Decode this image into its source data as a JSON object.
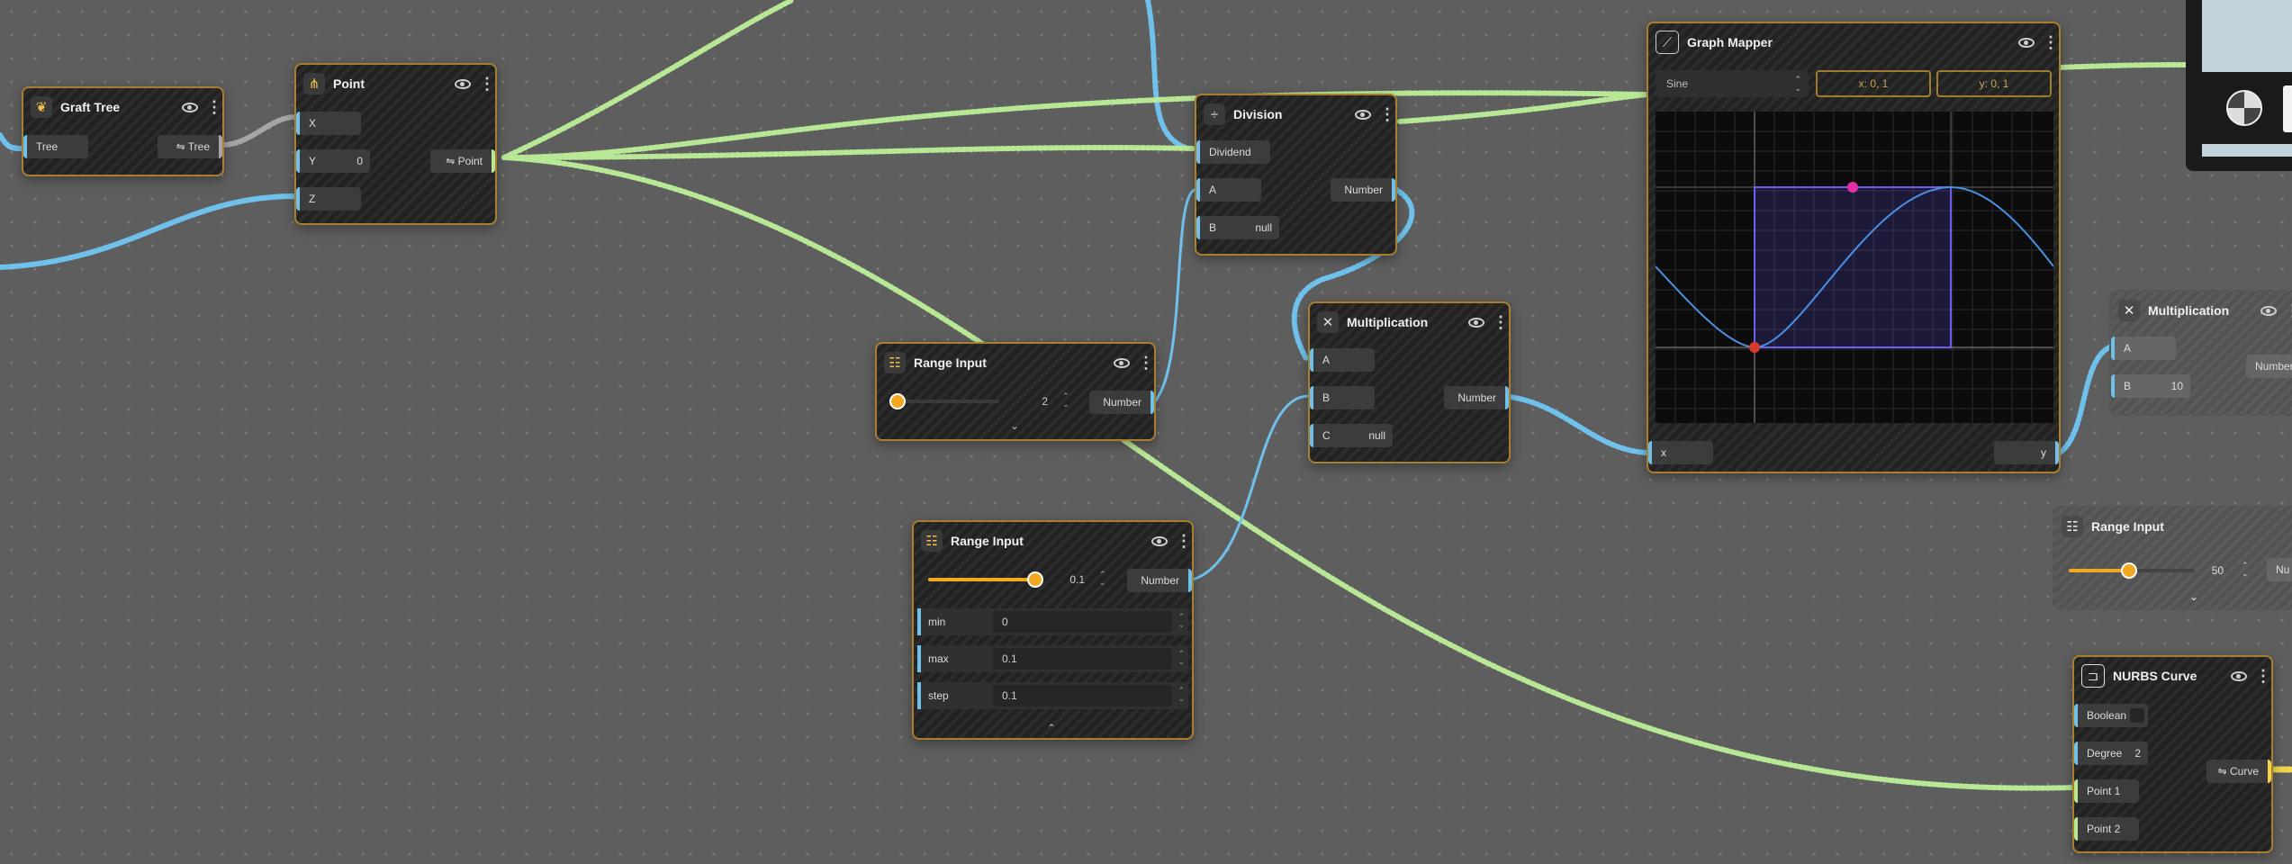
{
  "colors": {
    "background": "#5e5e5e",
    "node_border": "#a87f2e",
    "wire_number": "#6fc1ec",
    "wire_point": "#b8e896",
    "wire_tree": "#a6a6a6",
    "wire_curve": "#f0d54d",
    "slider_accent": "#f3a822",
    "graph_curve": "#4a90e2",
    "graph_region": "#5b4fd9"
  },
  "nodes": {
    "graft_tree": {
      "title": "Graft Tree",
      "icon": "graft-tree-icon",
      "in_tree": "Tree",
      "out_tree": "Tree",
      "out_icon": "⇋"
    },
    "point": {
      "title": "Point",
      "icon": "point-icon",
      "x_label": "X",
      "y_label": "Y",
      "y_value": "0",
      "z_label": "Z",
      "out_label": "Point",
      "out_icon": "⇋"
    },
    "division": {
      "title": "Division",
      "icon": "division-icon",
      "dividend": "Dividend",
      "a_label": "A",
      "b_label": "B",
      "b_value": "null",
      "out_label": "Number"
    },
    "multiplication_1": {
      "title": "Multiplication",
      "icon": "multiply-icon",
      "a_label": "A",
      "b_label": "B",
      "c_label": "C",
      "c_value": "null",
      "out_label": "Number"
    },
    "multiplication_2": {
      "title": "Multiplication",
      "icon": "multiply-icon",
      "a_label": "A",
      "b_label": "B",
      "b_value": "10",
      "out_label": "Number"
    },
    "range_input_1": {
      "title": "Range Input",
      "icon": "sliders-icon",
      "value": "2",
      "progress": 0.0,
      "out_label": "Number"
    },
    "range_input_2": {
      "title": "Range Input",
      "icon": "sliders-icon",
      "value": "0.1",
      "progress": 1.0,
      "out_label": "Number",
      "fields": [
        {
          "label": "min",
          "value": "0"
        },
        {
          "label": "max",
          "value": "0.1"
        },
        {
          "label": "step",
          "value": "0.1"
        }
      ]
    },
    "range_input_3": {
      "title": "Range Input",
      "icon": "sliders-icon",
      "value": "50",
      "progress": 0.5,
      "out_label": "Nu"
    },
    "graph_mapper": {
      "title": "Graph Mapper",
      "icon": "graph-icon",
      "mode": "Sine",
      "x_domain": "x: 0, 1",
      "y_domain": "y: 0, 1",
      "in_label": "x",
      "out_label": "y"
    },
    "nurbs_curve": {
      "title": "NURBS Curve",
      "icon": "curve-icon",
      "boolean_label": "Boolean",
      "degree_label": "Degree",
      "degree_value": "2",
      "point1": "Point 1",
      "point2": "Point 2",
      "out_label": "Curve",
      "out_icon": "⇋"
    }
  }
}
